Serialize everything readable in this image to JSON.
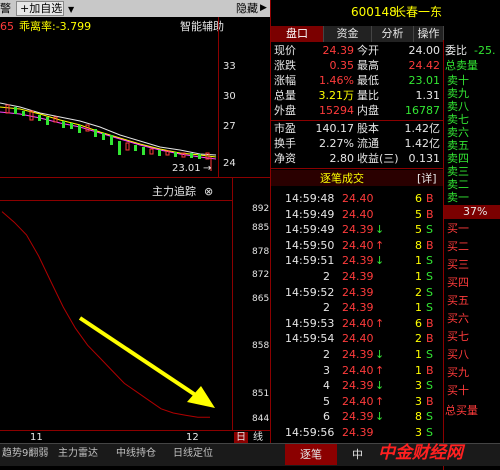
{
  "toolbar": {
    "left_cut": "警",
    "add_self": "+加自选",
    "dropdown": "▼",
    "hide": "隐藏",
    "hide_arrow": "▶"
  },
  "kline": {
    "left_cut": "65",
    "indicator": "乖离率:-3.799",
    "assist": "智能辅助",
    "y_ticks": [
      "33",
      "30",
      "27",
      "24"
    ],
    "low_label": "23.01",
    "low_arrow": "→"
  },
  "chip": {
    "title": "主力追踪",
    "menu": "⊗",
    "y_ticks": [
      "892",
      "885",
      "878",
      "872",
      "865",
      "858",
      "851",
      "844"
    ],
    "x_ticks": [
      "11",
      "12"
    ],
    "period_tabs": [
      "日",
      "线"
    ],
    "chart_data": {
      "type": "line",
      "series": [
        {
          "values": [
            892.5,
            890,
            887,
            882,
            876,
            870,
            865,
            861,
            858,
            855,
            852,
            850,
            848,
            846,
            845,
            844.5,
            844,
            844
          ]
        }
      ],
      "ylim": [
        841,
        895
      ]
    }
  },
  "quote": {
    "tabs": [
      "盘口",
      "资金",
      "分析",
      "操作"
    ],
    "code": "600148",
    "name": "长春一东",
    "rows": [
      {
        "l1": "现价",
        "v1": "24.39",
        "c1": "red",
        "l2": "今开",
        "v2": "24.00",
        "c2": "wht"
      },
      {
        "l1": "涨跌",
        "v1": "0.35",
        "c1": "red",
        "l2": "最高",
        "v2": "24.42",
        "c2": "red"
      },
      {
        "l1": "涨幅",
        "v1": "1.46%",
        "c1": "red",
        "l2": "最低",
        "v2": "23.01",
        "c2": "grn"
      },
      {
        "l1": "总量",
        "v1": "3.21万",
        "c1": "yel",
        "l2": "量比",
        "v2": "1.31",
        "c2": "wht"
      },
      {
        "l1": "外盘",
        "v1": "15294",
        "c1": "red",
        "l2": "内盘",
        "v2": "16787",
        "c2": "grn"
      },
      {
        "l1": "市盈",
        "v1": "140.17",
        "c1": "wht",
        "l2": "股本",
        "v2": "1.42亿",
        "c2": "wht"
      },
      {
        "l1": "换手",
        "v1": "2.27%",
        "c1": "wht",
        "l2": "流通",
        "v2": "1.42亿",
        "c2": "wht"
      },
      {
        "l1": "净资",
        "v1": "2.80",
        "c1": "wht",
        "l2": "收益(三)",
        "v2": "0.131",
        "c2": "wht"
      }
    ]
  },
  "trades": {
    "title": "逐笔成交",
    "detail": "详",
    "rows": [
      {
        "t": "14:59:48",
        "p": "24.40",
        "a": "",
        "v": "6",
        "d": "B"
      },
      {
        "t": "14:59:49",
        "p": "24.40",
        "a": "",
        "v": "5",
        "d": "B"
      },
      {
        "t": "14:59:49",
        "p": "24.39",
        "a": "↓",
        "v": "5",
        "d": "S"
      },
      {
        "t": "14:59:50",
        "p": "24.40",
        "a": "↑",
        "v": "8",
        "d": "B"
      },
      {
        "t": "14:59:51",
        "p": "24.39",
        "a": "↓",
        "v": "1",
        "d": "S"
      },
      {
        "t": "2",
        "p": "24.39",
        "a": "",
        "v": "1",
        "d": "S"
      },
      {
        "t": "14:59:52",
        "p": "24.39",
        "a": "",
        "v": "2",
        "d": "S"
      },
      {
        "t": "2",
        "p": "24.39",
        "a": "",
        "v": "1",
        "d": "S"
      },
      {
        "t": "14:59:53",
        "p": "24.40",
        "a": "↑",
        "v": "6",
        "d": "B"
      },
      {
        "t": "14:59:54",
        "p": "24.40",
        "a": "",
        "v": "2",
        "d": "B"
      },
      {
        "t": "2",
        "p": "24.39",
        "a": "↓",
        "v": "1",
        "d": "S"
      },
      {
        "t": "3",
        "p": "24.40",
        "a": "↑",
        "v": "1",
        "d": "B"
      },
      {
        "t": "4",
        "p": "24.39",
        "a": "↓",
        "v": "3",
        "d": "S"
      },
      {
        "t": "5",
        "p": "24.40",
        "a": "↑",
        "v": "3",
        "d": "B"
      },
      {
        "t": "6",
        "p": "24.39",
        "a": "↓",
        "v": "8",
        "d": "S"
      },
      {
        "t": "14:59:56",
        "p": "24.39",
        "a": "",
        "v": "3",
        "d": "S"
      }
    ]
  },
  "orderbook": {
    "header": [
      {
        "label": "委比",
        "value": "-25.",
        "color": "grn"
      },
      {
        "label": "总卖量",
        "value": "",
        "color": "grn"
      }
    ],
    "sells": [
      "卖十",
      "卖九",
      "卖八",
      "卖七",
      "卖六",
      "卖五",
      "卖四",
      "卖三",
      "卖二",
      "卖一"
    ],
    "ratio": "37%",
    "buys": [
      "买一",
      "买二",
      "买三",
      "买四",
      "买五",
      "买六",
      "买七",
      "买八",
      "买九",
      "买十"
    ],
    "footer": "总买量"
  },
  "bottom": {
    "left": [
      "趋势9翻弱",
      "主力雷达",
      "中线持仓",
      "日线定位"
    ],
    "right_tab": "逐笔",
    "right_cut": "中",
    "watermark": "中金财经网"
  },
  "colors": {
    "accent": "#8b0000",
    "up": "#ff3b3b",
    "down": "#33e633",
    "yellow": "#ffff00"
  }
}
